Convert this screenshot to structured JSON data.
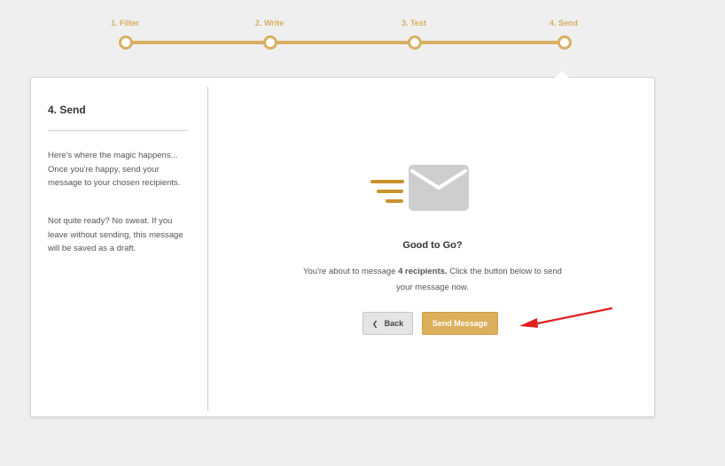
{
  "stepper": {
    "steps": [
      {
        "label": "1. Filter"
      },
      {
        "label": "2. Write"
      },
      {
        "label": "3. Test"
      },
      {
        "label": "4. Send"
      }
    ],
    "accent_color": "#d8b062"
  },
  "sidebar": {
    "title": "4. Send",
    "paragraph1": "Here's where the magic happens... Once you're happy, send your message to your chosen recipients.",
    "paragraph2": "Not quite ready? No sweat. If you leave without sending, this message will be saved as a draft."
  },
  "main": {
    "icon": "envelope-icon",
    "title": "Good to Go?",
    "desc_prefix": "You're about to message ",
    "desc_count": "4 recipients.",
    "desc_suffix": " Click the button below to send your message now.",
    "back_label": "Back",
    "send_label": "Send Message"
  },
  "annotation": {
    "color": "#e02020",
    "icon": "red-arrow-icon"
  }
}
